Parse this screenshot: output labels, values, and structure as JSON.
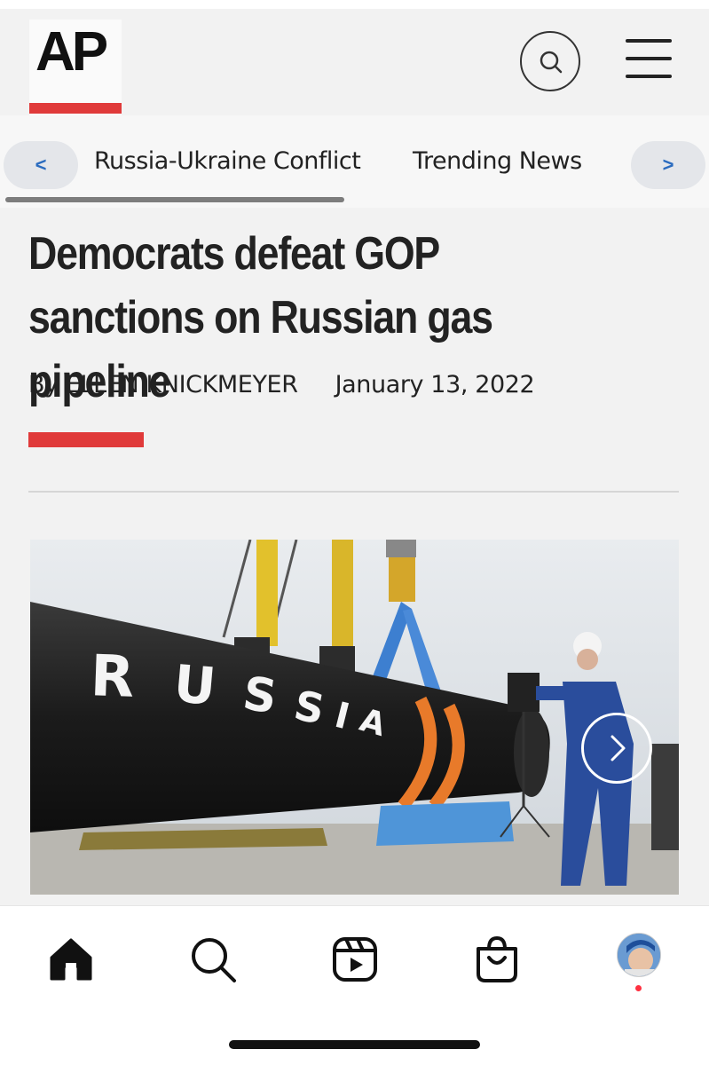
{
  "header": {
    "logo_text": "AP",
    "accent_color": "#e03a3a"
  },
  "nav": {
    "prev_label": "<",
    "next_label": ">",
    "links": [
      "Russia-Ukraine Conflict",
      "Trending News"
    ]
  },
  "article": {
    "headline": "Democrats defeat GOP sanctions on Russian gas pipeline",
    "author": "By ELLEN KNICKMEYER",
    "date": "January 13, 2022",
    "image_text": [
      "R",
      "U",
      "S",
      "S",
      "I",
      "A"
    ]
  },
  "tabbar": {
    "items": [
      "home-icon",
      "search-icon",
      "reels-icon",
      "shop-icon",
      "profile-avatar"
    ],
    "active": "home-icon",
    "notification_color": "#ff3040"
  }
}
